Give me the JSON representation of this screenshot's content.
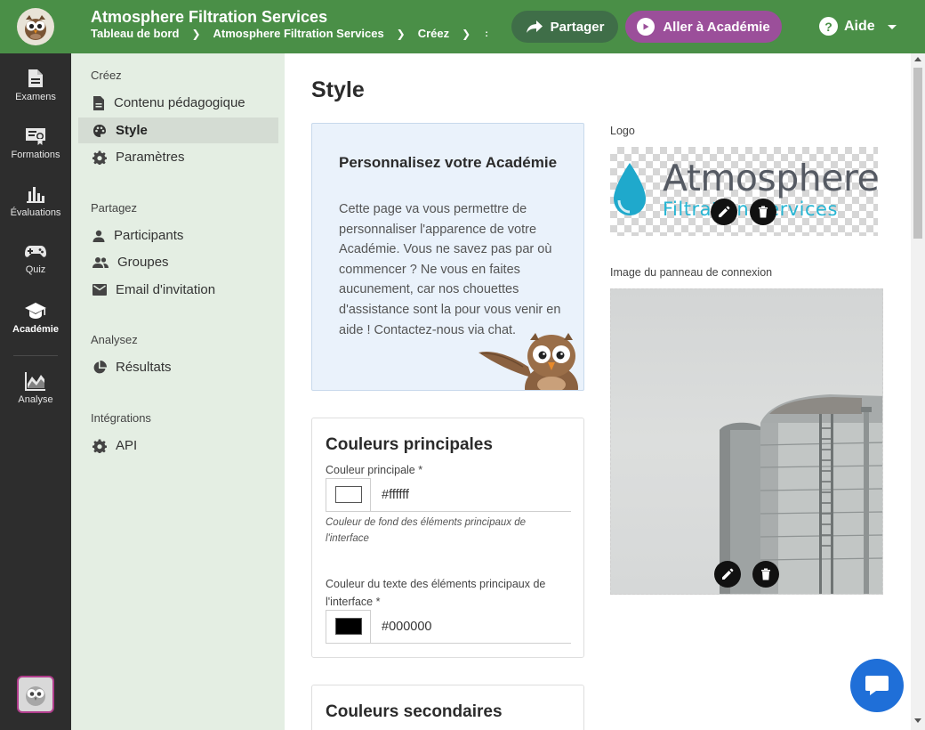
{
  "header": {
    "title": "Atmosphere Filtration Services",
    "breadcrumb": [
      "Tableau de bord",
      "Atmosphere Filtration Services",
      "Créez"
    ],
    "breadcrumb_more": ":",
    "share_label": "Partager",
    "academy_label": "Aller à Académie",
    "help_label": "Aide",
    "help_glyph": "?"
  },
  "rail": {
    "items": [
      {
        "label": "Examens",
        "icon": "document-icon"
      },
      {
        "label": "Formations",
        "icon": "certificate-icon"
      },
      {
        "label": "Évaluations",
        "icon": "bar-chart-icon"
      },
      {
        "label": "Quiz",
        "icon": "gamepad-icon"
      },
      {
        "label": "Académie",
        "icon": "graduation-cap-icon",
        "active": true
      },
      {
        "label": "Analyse",
        "icon": "area-chart-icon"
      }
    ]
  },
  "sidenav": {
    "sections": [
      {
        "title": "Créez",
        "items": [
          {
            "label": "Contenu pédagogique",
            "icon": "file-icon"
          },
          {
            "label": "Style",
            "icon": "palette-icon",
            "active": true
          },
          {
            "label": "Paramètres",
            "icon": "gear-icon"
          }
        ]
      },
      {
        "title": "Partagez",
        "items": [
          {
            "label": "Participants",
            "icon": "person-icon"
          },
          {
            "label": "Groupes",
            "icon": "group-icon"
          },
          {
            "label": "Email d'invitation",
            "icon": "mail-icon"
          }
        ]
      },
      {
        "title": "Analysez",
        "items": [
          {
            "label": "Résultats",
            "icon": "pie-chart-icon"
          }
        ]
      },
      {
        "title": "Intégrations",
        "items": [
          {
            "label": "API",
            "icon": "gear-icon"
          }
        ]
      }
    ]
  },
  "main": {
    "page_title": "Style",
    "info_card": {
      "title": "Personnalisez votre Académie",
      "text": "Cette page va vous permettre de personnaliser l'apparence de votre Académie. Vous ne savez pas par où commencer ? Ne vous en faites aucunement, car nos chouettes d'assistance sont la pour vous venir en aide ! Contactez-nous via chat."
    },
    "primary_colors": {
      "title": "Couleurs principales",
      "main_color_label": "Couleur principale *",
      "main_color_value": "#ffffff",
      "main_color_hint": "Couleur de fond des éléments principaux de l'interface",
      "text_color_label": "Couleur du texte des éléments principaux de l'interface *",
      "text_color_value": "#000000"
    },
    "secondary_colors": {
      "title": "Couleurs secondaires"
    },
    "logo": {
      "label": "Logo",
      "word": "Atmosphere",
      "sub": "Filtration Services"
    },
    "login_image": {
      "label": "Image du panneau de connexion"
    }
  },
  "colors": {
    "topbar": "#4a8f47",
    "academy_button": "#9b4f9a",
    "share_button": "#3f6e48",
    "rail": "#2d2d2d",
    "sidenav": "#e4eee3",
    "info_card": "#eaf2fb",
    "chat": "#1f6fd8",
    "logo_drop": "#1fa9cc"
  }
}
